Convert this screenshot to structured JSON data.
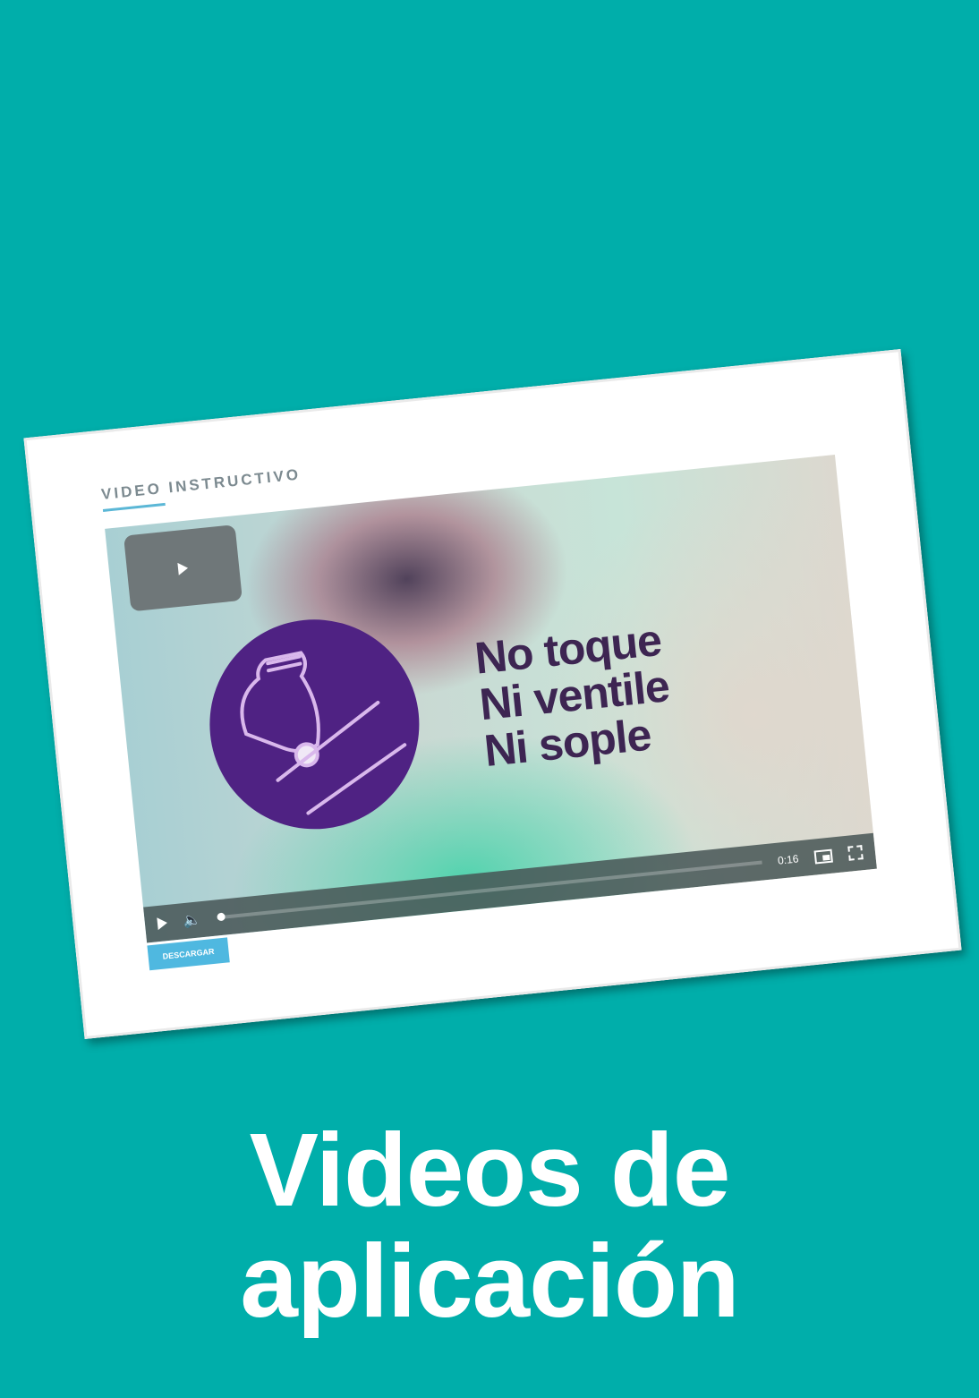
{
  "colors": {
    "background": "#00aeaa",
    "accent_purple": "#4f2283",
    "button_blue": "#4fb8e0"
  },
  "card": {
    "section_title": "VIDEO INSTRUCTIVO",
    "video": {
      "slogan": [
        "No toque",
        "Ni ventile",
        "Ni sople"
      ],
      "icon": "hand-pressing-applicator-icon",
      "controls": {
        "time": "0:16",
        "progress": 0
      }
    },
    "download_label": "DESCARGAR"
  },
  "headline": [
    "Videos de",
    "aplicación"
  ]
}
